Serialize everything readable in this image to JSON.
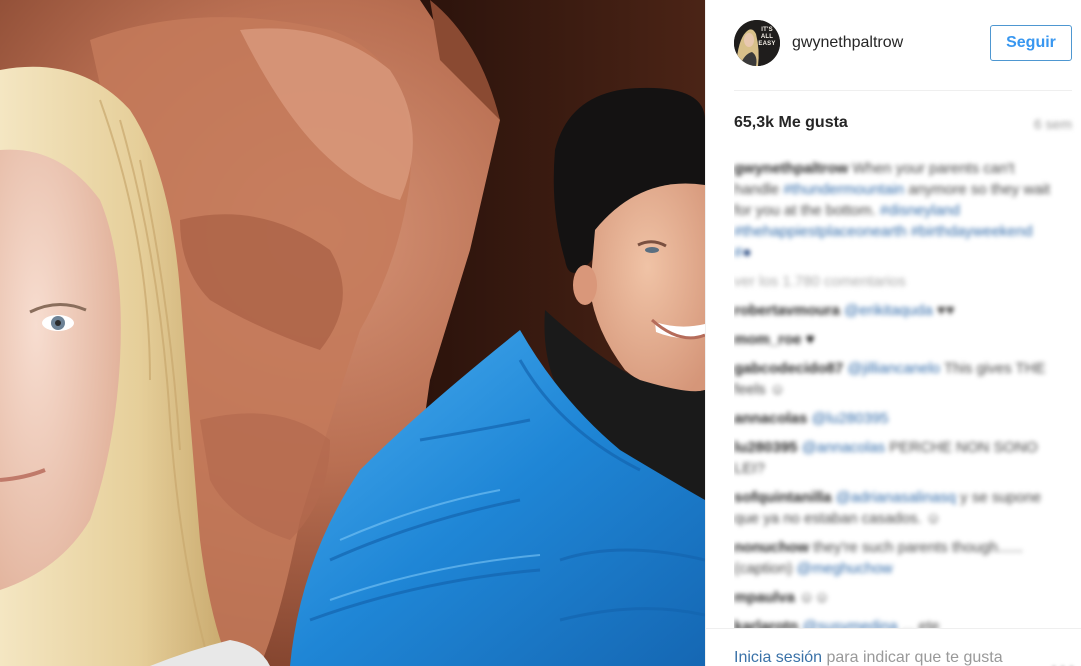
{
  "post": {
    "username": "gwynethpaltrow",
    "avatar_text": "IT'S ALL EASY",
    "follow_label": "Seguir",
    "likes": "65,3k Me gusta",
    "time_ago": "6 sem"
  },
  "caption": {
    "user": "gwynethpaltrow",
    "text": "When your parents can't handle",
    "tag1": "#thundermountain",
    "text2": "anymore so they wait for you at the bottom.",
    "tags": "#disneyland #thehappiestplaceonearth #birthdayweekend #",
    "emoji": "●"
  },
  "view_all": "ver los 1.780 comentarios",
  "comments": [
    {
      "user": "robertavmoura",
      "tag": "@erikitaquda",
      "text": "♥♥"
    },
    {
      "user": "mom_roe",
      "tag": "",
      "text": "♥"
    },
    {
      "user": "gabcodecido87",
      "tag": "@jilliancanelo",
      "text": "This gives THE feels ☺"
    },
    {
      "user": "annacolas",
      "tag": "@lu280395",
      "text": ""
    },
    {
      "user": "lu280395",
      "tag": "@annacolas",
      "text": "PERCHE NON SONO LEI?"
    },
    {
      "user": "sofquintanilla",
      "tag": "@adrianasalinasq",
      "text": "y se supone que ya no estaban casados. ☺"
    },
    {
      "user": "nonuchow",
      "tag": "",
      "text": "they're such parents though...... (caption)",
      "tag2": "@meghuchow"
    },
    {
      "user": "mpaulva",
      "tag": "",
      "text": "☺☺"
    },
    {
      "user": "karlarotn",
      "tag": "@susymedina",
      "text": "... ete"
    }
  ],
  "footer": {
    "login_link": "Inicia sesión",
    "login_rest": " para indicar que te gusta",
    "more": "• • •"
  },
  "colors": {
    "accent": "#3897f0",
    "link": "#3a72a8",
    "jacket": "#2a8fd8",
    "rock": "#b86a4c"
  }
}
